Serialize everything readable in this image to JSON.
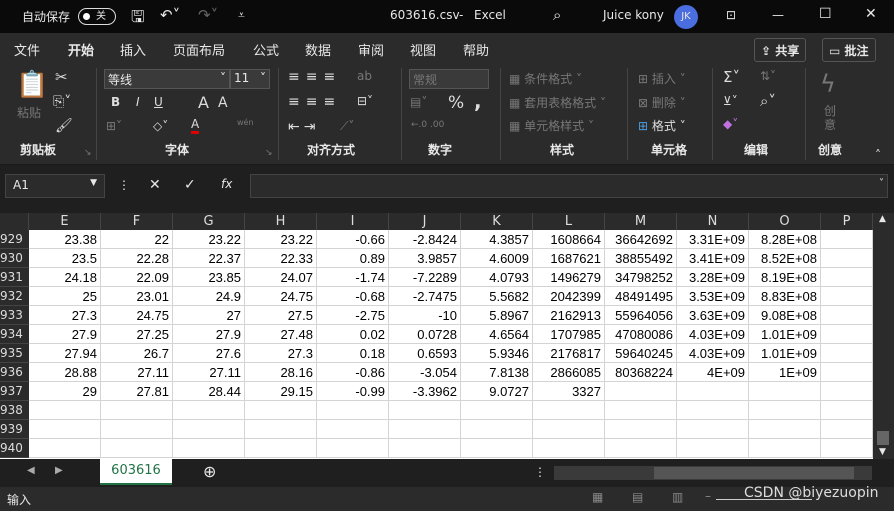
{
  "titlebar": {
    "autosave_label": "自动保存",
    "autosave_state": "关",
    "filename": "603616.csv",
    "separator": "-",
    "app": "Excel",
    "user": "Juice kony",
    "avatar_initials": "JK"
  },
  "tabs": [
    "文件",
    "开始",
    "插入",
    "页面布局",
    "公式",
    "数据",
    "审阅",
    "视图",
    "帮助"
  ],
  "active_tab": "开始",
  "share_label": "共享",
  "comment_label": "批注",
  "ribbon": {
    "clipboard": {
      "paste": "粘贴",
      "group": "剪贴板"
    },
    "font": {
      "name": "等线",
      "size": "11",
      "bold": "B",
      "italic": "I",
      "underline": "U",
      "grow": "A",
      "shrink": "A",
      "font_color": "A",
      "phonetic": "wén",
      "group": "字体"
    },
    "alignment": {
      "group": "对齐方式"
    },
    "number": {
      "format": "常规",
      "percent": "%",
      "comma": ",",
      "group": "数字"
    },
    "styles": {
      "conditional": "条件格式",
      "table": "套用表格格式",
      "cell_styles": "单元格样式",
      "group": "样式"
    },
    "cells": {
      "insert": "插入",
      "delete": "删除",
      "format": "格式",
      "group": "单元格"
    },
    "editing": {
      "sum": "Σ",
      "group": "编辑"
    },
    "creativity": {
      "label": "创意",
      "group": "创意"
    }
  },
  "namebox": "A1",
  "formula": "",
  "columns": [
    "E",
    "F",
    "G",
    "H",
    "I",
    "J",
    "K",
    "L",
    "M",
    "N",
    "O",
    "P"
  ],
  "rows": [
    {
      "n": "929",
      "cells": [
        "23.38",
        "22",
        "23.22",
        "23.22",
        "-0.66",
        "-2.8424",
        "4.3857",
        "1608664",
        "36642692",
        "3.31E+09",
        "8.28E+08",
        ""
      ]
    },
    {
      "n": "930",
      "cells": [
        "23.5",
        "22.28",
        "22.37",
        "22.33",
        "0.89",
        "3.9857",
        "4.6009",
        "1687621",
        "38855492",
        "3.41E+09",
        "8.52E+08",
        ""
      ]
    },
    {
      "n": "931",
      "cells": [
        "24.18",
        "22.09",
        "23.85",
        "24.07",
        "-1.74",
        "-7.2289",
        "4.0793",
        "1496279",
        "34798252",
        "3.28E+09",
        "8.19E+08",
        ""
      ]
    },
    {
      "n": "932",
      "cells": [
        "25",
        "23.01",
        "24.9",
        "24.75",
        "-0.68",
        "-2.7475",
        "5.5682",
        "2042399",
        "48491495",
        "3.53E+09",
        "8.83E+08",
        ""
      ]
    },
    {
      "n": "933",
      "cells": [
        "27.3",
        "24.75",
        "27",
        "27.5",
        "-2.75",
        "-10",
        "5.8967",
        "2162913",
        "55964056",
        "3.63E+09",
        "9.08E+08",
        ""
      ]
    },
    {
      "n": "934",
      "cells": [
        "27.9",
        "27.25",
        "27.9",
        "27.48",
        "0.02",
        "0.0728",
        "4.6564",
        "1707985",
        "47080086",
        "4.03E+09",
        "1.01E+09",
        ""
      ]
    },
    {
      "n": "935",
      "cells": [
        "27.94",
        "26.7",
        "27.6",
        "27.3",
        "0.18",
        "0.6593",
        "5.9346",
        "2176817",
        "59640245",
        "4.03E+09",
        "1.01E+09",
        ""
      ]
    },
    {
      "n": "936",
      "cells": [
        "28.88",
        "27.11",
        "27.11",
        "28.16",
        "-0.86",
        "-3.054",
        "7.8138",
        "2866085",
        "80368224",
        "4E+09",
        "1E+09",
        ""
      ]
    },
    {
      "n": "937",
      "cells": [
        "29",
        "27.81",
        "28.44",
        "29.15",
        "-0.99",
        "-3.3962",
        "9.0727",
        "3327",
        "",
        "",
        "",
        ""
      ]
    },
    {
      "n": "938",
      "cells": [
        "",
        "",
        "",
        "",
        "",
        "",
        "",
        "",
        "",
        "",
        "",
        ""
      ]
    },
    {
      "n": "939",
      "cells": [
        "",
        "",
        "",
        "",
        "",
        "",
        "",
        "",
        "",
        "",
        "",
        ""
      ]
    },
    {
      "n": "940",
      "cells": [
        "",
        "",
        "",
        "",
        "",
        "",
        "",
        "",
        "",
        "",
        "",
        ""
      ]
    }
  ],
  "sheet_tab": "603616",
  "status": "输入",
  "watermark": "CSDN @biyezuopin"
}
